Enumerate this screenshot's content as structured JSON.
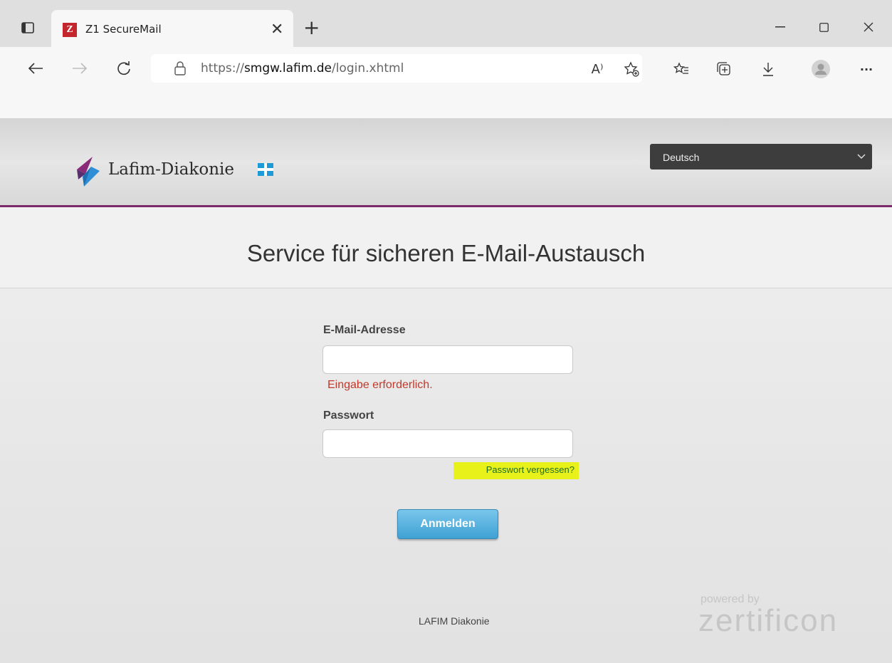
{
  "browser": {
    "tab_title": "Z1 SecureMail",
    "tab_favicon_letter": "Z",
    "url_prefix": "https://",
    "url_domain": "smgw.lafim.de",
    "url_path": "/login.xhtml",
    "read_aloud_label": "A⁾",
    "menu_label": "···"
  },
  "header": {
    "logo_text": "Lafim-Diakonie",
    "language": "Deutsch"
  },
  "main": {
    "title": "Service für sicheren E-Mail-Austausch",
    "email_label": "E-Mail-Adresse",
    "email_value": "",
    "email_error": "Eingabe erforderlich.",
    "password_label": "Passwort",
    "password_value": "",
    "forgot_link": "Passwort vergessen?",
    "submit_label": "Anmelden"
  },
  "footer": {
    "org": "LAFIM Diakonie",
    "powered_by": "powered by",
    "brand": "zertificon"
  },
  "colors": {
    "header_accent": "#7b2a6a",
    "button": "#3fa1d3",
    "error": "#c0392b",
    "highlight": "#e8f21a"
  }
}
